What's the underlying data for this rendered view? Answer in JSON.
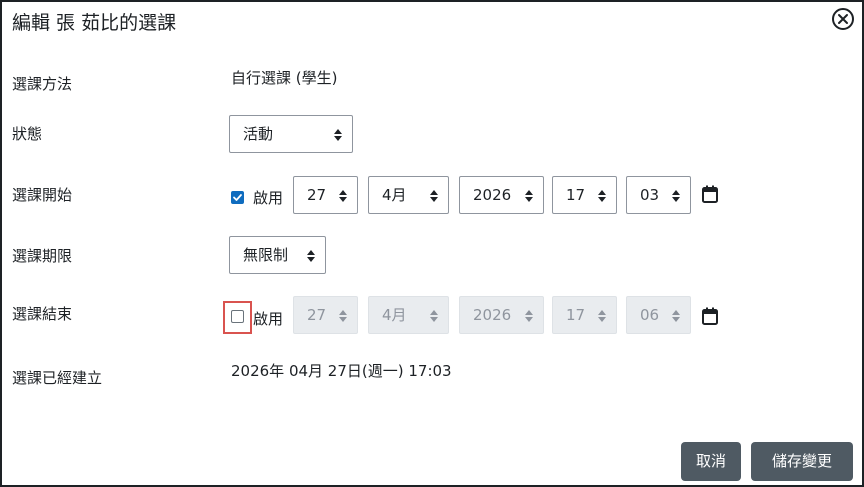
{
  "dialog": {
    "title": "編輯 張 茹比的選課"
  },
  "fields": {
    "method": {
      "label": "選課方法",
      "value": "自行選課 (學生)"
    },
    "status": {
      "label": "狀態",
      "selected": "活動"
    },
    "start": {
      "label": "選課開始",
      "enabled": true,
      "enable_label": "啟用",
      "day": "27",
      "month": "4月",
      "year": "2026",
      "hour": "17",
      "minute": "03"
    },
    "duration": {
      "label": "選課期限",
      "selected": "無限制"
    },
    "end": {
      "label": "選課結束",
      "enabled": false,
      "enable_label": "啟用",
      "day": "27",
      "month": "4月",
      "year": "2026",
      "hour": "17",
      "minute": "06"
    },
    "created": {
      "label": "選課已經建立",
      "value": "2026年 04月 27日(週一) 17:03"
    }
  },
  "buttons": {
    "cancel": "取消",
    "save": "儲存變更"
  },
  "icons": {
    "close": "close-circle-icon",
    "calendar": "calendar-icon",
    "select_arrows": "sort-arrows-icon",
    "check": "checkmark-icon"
  },
  "colors": {
    "primary": "#0f6cbf",
    "button_secondary": "#4f5a63",
    "focus_ring": "#d9534f",
    "disabled_bg": "#e9ecef"
  }
}
